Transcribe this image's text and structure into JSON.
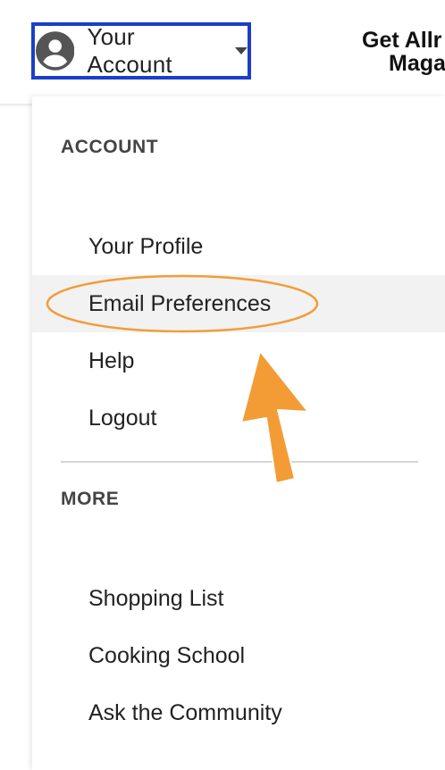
{
  "header": {
    "account_label": "Your Account",
    "promo_line1": "Get Allr",
    "promo_line2": "Maga",
    "highlight_color": "#1a3fc9",
    "icons": [
      "account-circle-icon",
      "caret-down-icon"
    ]
  },
  "menu": {
    "account_section": {
      "title": "ACCOUNT",
      "items": [
        {
          "label": "Your Profile"
        },
        {
          "label": "Email Preferences",
          "highlighted": true
        },
        {
          "label": "Help"
        },
        {
          "label": "Logout"
        }
      ]
    },
    "more_section": {
      "title": "MORE",
      "items": [
        {
          "label": "Shopping List"
        },
        {
          "label": "Cooking School"
        },
        {
          "label": "Ask the Community"
        }
      ]
    }
  },
  "annotation": {
    "color": "#f39c36",
    "shapes": [
      "ellipse-around-email-preferences",
      "arrow-pointing-up"
    ]
  }
}
